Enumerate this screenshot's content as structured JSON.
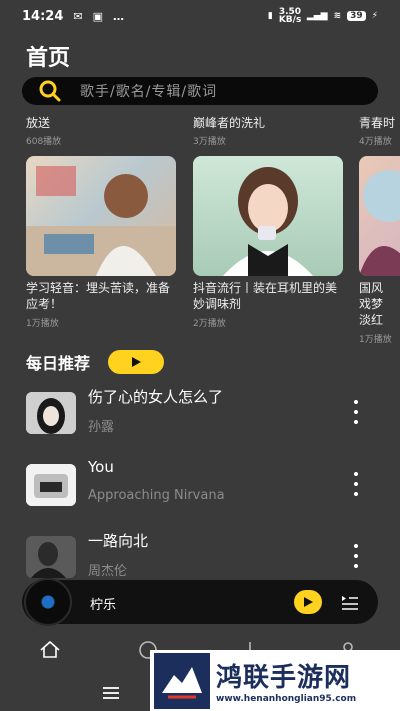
{
  "status": {
    "time": "14:24",
    "speed": "3.50 KB/s",
    "battery": "39"
  },
  "page": {
    "title": "首页"
  },
  "search": {
    "placeholder": "歌手/歌名/专辑/歌词"
  },
  "top_cards": [
    {
      "title": "放送",
      "plays": "608播放"
    },
    {
      "title": "巅峰者的洗礼",
      "plays": "3万播放"
    },
    {
      "title": "青春时",
      "plays": "4万播放"
    }
  ],
  "playlists": [
    {
      "title": "学习轻音：埋头苦读，准备应考！",
      "plays": "1万播放"
    },
    {
      "title": "抖音流行丨装在耳机里的美妙调味剂",
      "plays": "2万播放"
    },
    {
      "title": "国风戏梦淡红",
      "plays": "1万播放"
    }
  ],
  "daily": {
    "label": "每日推荐"
  },
  "songs": [
    {
      "name": "伤了心的女人怎么了",
      "artist": "孙露"
    },
    {
      "name": "You",
      "artist": "Approaching Nirvana"
    },
    {
      "name": "一路向北",
      "artist": "周杰伦"
    }
  ],
  "player": {
    "song": "柠乐"
  },
  "watermark": {
    "name": "鸿联手游网",
    "url": "www.henanhonglian95.com"
  },
  "colors": {
    "accent": "#ffd21f",
    "background": "#3a3a3a"
  }
}
